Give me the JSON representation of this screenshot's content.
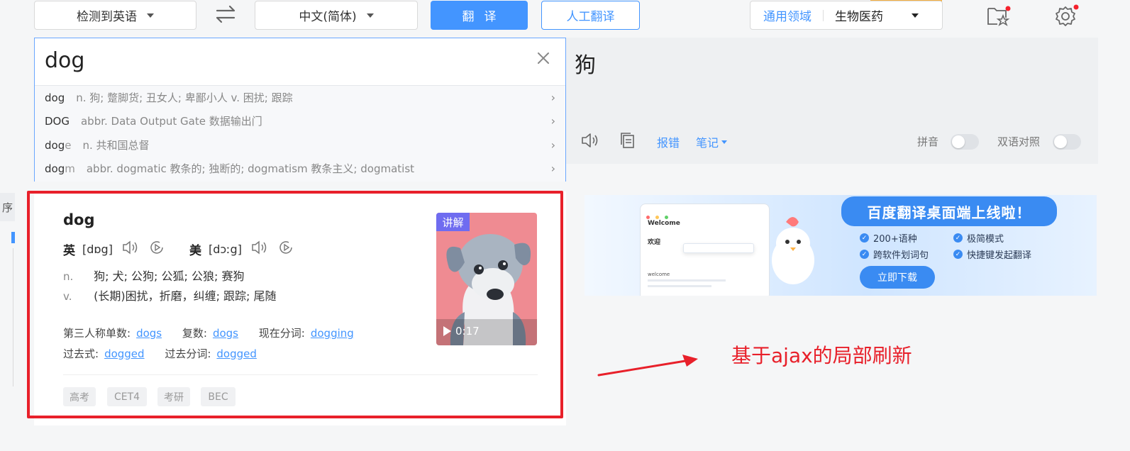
{
  "toolbar": {
    "source_lang": "检测到英语",
    "target_lang": "中文(简体)",
    "translate_label": "翻译",
    "human_translate_label": "人工翻译",
    "domain_general": "通用领域",
    "domain_selected": "生物医药"
  },
  "input": {
    "query": "dog",
    "suggestions": [
      {
        "word": "dog",
        "word_light": "",
        "def": "n. 狗; 蹩脚货; 丑女人; 卑鄙小人 v. 困扰; 跟踪"
      },
      {
        "word": "DOG",
        "word_light": "",
        "def": "abbr. Data Output Gate 数据输出门"
      },
      {
        "word": "dog",
        "word_light": "e",
        "def": "n. 共和国总督"
      },
      {
        "word": "dog",
        "word_light": "m",
        "def": "abbr. dogmatic 教条的; 独断的; dogmatism 教条主义; dogmatist"
      }
    ]
  },
  "output": {
    "result": "狗",
    "report_label": "报错",
    "notes_label": "笔记",
    "pinyin_label": "拼音",
    "bilingual_label": "双语对照"
  },
  "dict": {
    "word": "dog",
    "uk_label": "英",
    "uk_phonetic": "[dɒg]",
    "us_label": "美",
    "us_phonetic": "[dɔːg]",
    "senses": [
      {
        "pos": "n.",
        "meaning": "狗;  犬;  公狗;  公狐;  公狼;  赛狗"
      },
      {
        "pos": "v.",
        "meaning": "(长期)困扰，折磨，纠缠;  跟踪;  尾随"
      }
    ],
    "inflections": {
      "third_person_label": "第三人称单数:",
      "third_person": "dogs",
      "plural_label": "复数:",
      "plural": "dogs",
      "present_participle_label": "现在分词:",
      "present_participle": "dogging",
      "past_label": "过去式:",
      "past": "dogged",
      "past_participle_label": "过去分词:",
      "past_participle": "dogged"
    },
    "video": {
      "badge": "讲解",
      "duration": "0:17"
    },
    "tags": [
      "高考",
      "CET4",
      "考研",
      "BEC"
    ]
  },
  "banner": {
    "headline": "百度翻译桌面端上线啦！",
    "features": [
      "200+语种",
      "极简模式",
      "跨软件划词句",
      "快捷键发起翻译"
    ],
    "download_label": "立即下载",
    "mock_app_title": "Welcome",
    "mock_app_text": "欢迎",
    "mock_app_word": "welcome"
  },
  "annotation": "基于ajax的局部刷新",
  "sidebar_fragment": "序",
  "colors": {
    "accent": "#4395ff",
    "annotation_red": "#e8202a",
    "badge_purple": "#6f6cf0"
  }
}
